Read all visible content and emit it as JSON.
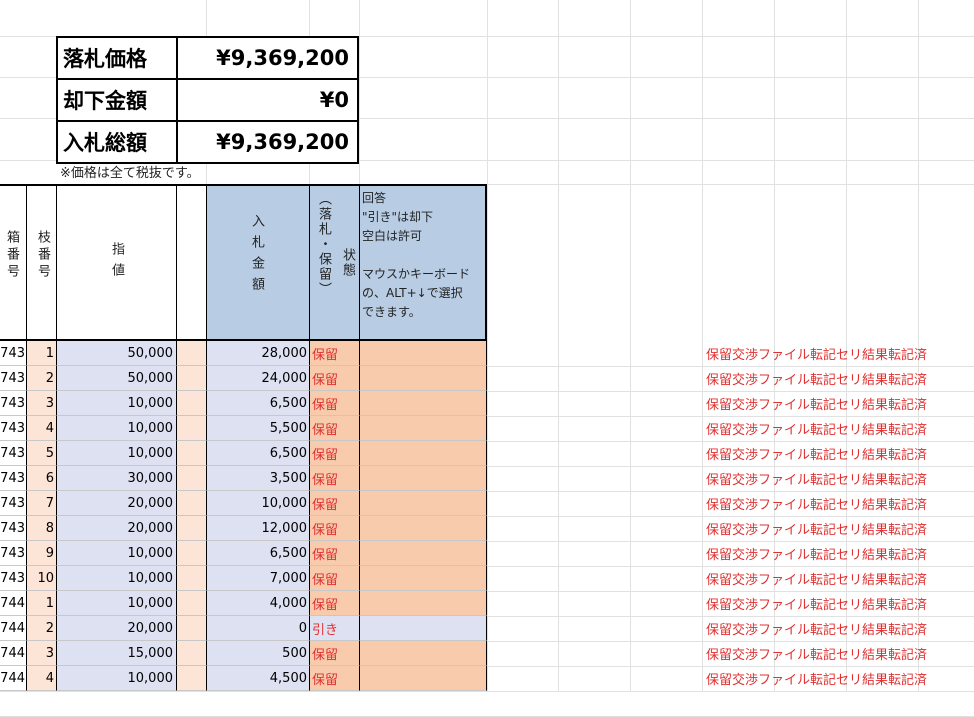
{
  "summary": [
    {
      "label": "落札価格",
      "value": "¥9,369,200"
    },
    {
      "label": "却下金額",
      "value": "¥0"
    },
    {
      "label": "入札総額",
      "value": "¥9,369,200"
    }
  ],
  "note": "※価格は全て税抜です。",
  "headers": {
    "box": "箱番号",
    "eda": "枝番号",
    "sasi": "指値",
    "bid": "入札金額",
    "status_paren": "（落札・保留）",
    "status_label": "状態",
    "answer_lines": [
      "回答",
      "\"引き\"は却下",
      "空白は許可",
      "",
      "マウスかキーボード",
      "の、ALT+↓で選択",
      "できます。"
    ]
  },
  "rows": [
    {
      "box": "743",
      "eda": "1",
      "sasi": "50,000",
      "bid": "28,000",
      "status": "保留"
    },
    {
      "box": "743",
      "eda": "2",
      "sasi": "50,000",
      "bid": "24,000",
      "status": "保留"
    },
    {
      "box": "743",
      "eda": "3",
      "sasi": "10,000",
      "bid": "6,500",
      "status": "保留"
    },
    {
      "box": "743",
      "eda": "4",
      "sasi": "10,000",
      "bid": "5,500",
      "status": "保留"
    },
    {
      "box": "743",
      "eda": "5",
      "sasi": "10,000",
      "bid": "6,500",
      "status": "保留"
    },
    {
      "box": "743",
      "eda": "6",
      "sasi": "30,000",
      "bid": "3,500",
      "status": "保留"
    },
    {
      "box": "743",
      "eda": "7",
      "sasi": "20,000",
      "bid": "10,000",
      "status": "保留"
    },
    {
      "box": "743",
      "eda": "8",
      "sasi": "20,000",
      "bid": "12,000",
      "status": "保留"
    },
    {
      "box": "743",
      "eda": "9",
      "sasi": "10,000",
      "bid": "6,500",
      "status": "保留"
    },
    {
      "box": "743",
      "eda": "10",
      "sasi": "10,000",
      "bid": "7,000",
      "status": "保留"
    },
    {
      "box": "744",
      "eda": "1",
      "sasi": "10,000",
      "bid": "4,000",
      "status": "保留"
    },
    {
      "box": "744",
      "eda": "2",
      "sasi": "20,000",
      "bid": "0",
      "status": "引き"
    },
    {
      "box": "744",
      "eda": "3",
      "sasi": "15,000",
      "bid": "500",
      "status": "保留"
    },
    {
      "box": "744",
      "eda": "4",
      "sasi": "10,000",
      "bid": "4,500",
      "status": "保留"
    }
  ],
  "side_text": "保留交渉ファイル転記セリ結果転記済",
  "colors": {
    "sasi_bg": "#dde1f2",
    "bid_bg": "#dde1f2",
    "header_bg": "#b8cce4",
    "answer_bg": "#f8cbad",
    "blank_bg": "#fce4d6",
    "status_red": "#e03030",
    "eda_bg": "#fce4d6"
  }
}
